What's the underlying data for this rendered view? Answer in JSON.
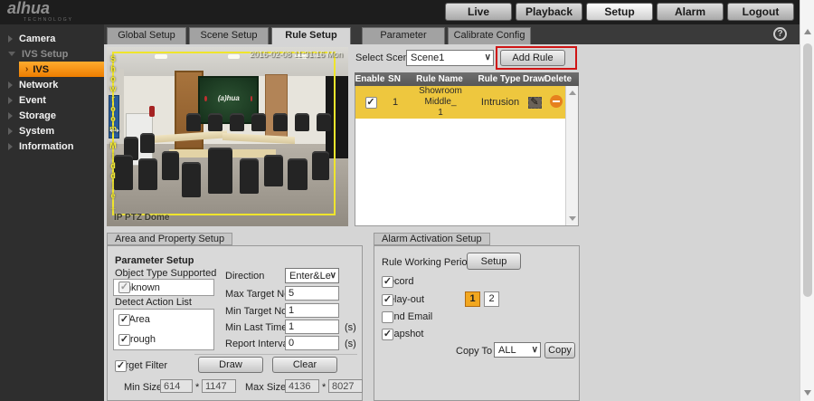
{
  "icons": {
    "chevron_down": "∨",
    "help": "?",
    "check": "✓",
    "active_arrow": "›",
    "double_arrow": "↔",
    "pencil": "✎"
  },
  "header": {
    "logo_brand": "alhua",
    "logo_sub": "TECHNOLOGY",
    "nav": [
      {
        "label": "Live",
        "active": false
      },
      {
        "label": "Playback",
        "active": false
      },
      {
        "label": "Setup",
        "active": true
      },
      {
        "label": "Alarm",
        "active": false
      },
      {
        "label": "Logout",
        "active": false
      }
    ]
  },
  "sidebar": {
    "items": [
      {
        "label": "Camera"
      },
      {
        "label": "IVS Setup"
      },
      {
        "label": "IVS"
      },
      {
        "label": "Network"
      },
      {
        "label": "Event"
      },
      {
        "label": "Storage"
      },
      {
        "label": "System"
      },
      {
        "label": "Information"
      }
    ]
  },
  "tabs": [
    {
      "label": "Global Setup"
    },
    {
      "label": "Scene Setup"
    },
    {
      "label": "Rule Setup",
      "active": true
    },
    {
      "label": "Parameter"
    },
    {
      "label": "Calibrate Config"
    }
  ],
  "video": {
    "osd_timestamp": "2016-02-08 11:31:16 Mon",
    "camera_name": "IP PTZ Dome",
    "rule_label_line1": "Showroom",
    "rule_label_line2": "Middle_",
    "wall_logo": "(a)hua"
  },
  "rule_controls": {
    "select_scene_label": "Select Scene",
    "scene_value": "Scene1",
    "add_rule_label": "Add Rule"
  },
  "rules_table": {
    "headers": [
      "Enable",
      "SN",
      "Rule Name",
      "Rule Type",
      "Draw",
      "Delete"
    ],
    "rows": [
      {
        "enabled": true,
        "sn": "1",
        "name": "Showroom Middle_\n1",
        "type": "Intrusion"
      }
    ]
  },
  "area_property": {
    "title": "Area and Property Setup",
    "parameter_setup_label": "Parameter Setup",
    "object_type_label": "Object Type Supported",
    "object_types": [
      {
        "label": "Unknown",
        "checked": true
      }
    ],
    "detect_action_label": "Detect Action List",
    "detect_actions": [
      {
        "label": "In Area",
        "checked": true
      },
      {
        "label": "Through",
        "checked": true
      }
    ],
    "direction_label": "Direction",
    "direction_value": "Enter&Le",
    "fields": [
      {
        "label": "Max Target No.",
        "value": "5",
        "unit": ""
      },
      {
        "label": "Min Target No.",
        "value": "1",
        "unit": ""
      },
      {
        "label": "Min Last Time",
        "value": "1",
        "unit": "(s)"
      },
      {
        "label": "Report Interval",
        "value": "0",
        "unit": "(s)"
      }
    ],
    "target_filter": {
      "label": "Target Filter",
      "checked": true
    },
    "draw_label": "Draw",
    "clear_label": "Clear",
    "min_size": {
      "label": "Min Size",
      "w": "614",
      "sep": "*",
      "h": "1147"
    },
    "max_size": {
      "label": "Max Size",
      "w": "4136",
      "sep": "*",
      "h": "8027"
    }
  },
  "alarm_activation": {
    "title": "Alarm Activation Setup",
    "rule_working_period_label": "Rule Working Period",
    "setup_label": "Setup",
    "options": [
      {
        "label": "Record",
        "checked": true
      },
      {
        "label": "Relay-out",
        "checked": true
      },
      {
        "label": "Send Email",
        "checked": false
      },
      {
        "label": "Snapshot",
        "checked": true
      }
    ],
    "relay_channels": [
      {
        "label": "1",
        "active": true
      },
      {
        "label": "2",
        "active": false
      }
    ],
    "copy_to_label": "Copy To",
    "copy_to_value": "ALL",
    "copy_label": "Copy"
  }
}
